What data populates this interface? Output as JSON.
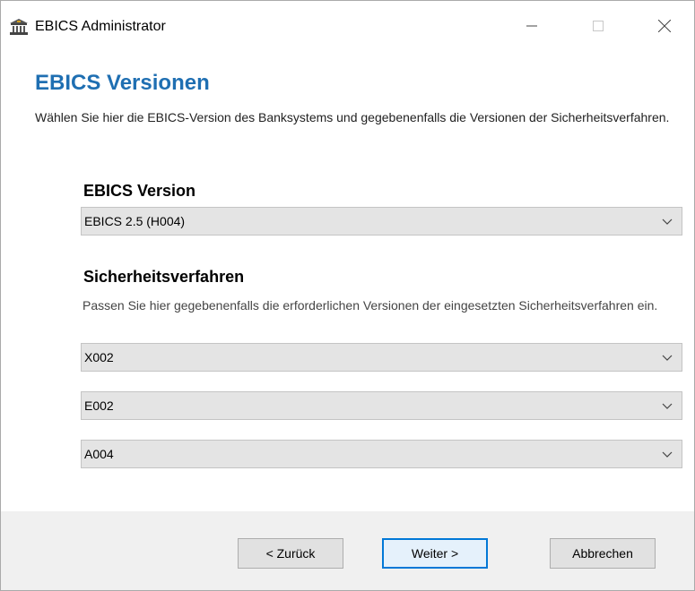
{
  "window": {
    "title": "EBICS Administrator",
    "icon": "bank-icon"
  },
  "page": {
    "heading": "EBICS Versionen",
    "description": "Wählen Sie hier die EBICS-Version des Banksystems und gegebenenfalls die Versionen der Sicherheitsverfahren."
  },
  "ebics_version": {
    "title": "EBICS Version",
    "selected": "EBICS 2.5 (H004)"
  },
  "security": {
    "title": "Sicherheitsverfahren",
    "description": "Passen Sie hier gegebenenfalls die erforderlichen Versionen der eingesetzten Sicherheitsverfahren ein.",
    "dropdowns": [
      "X002",
      "E002",
      "A004"
    ]
  },
  "buttons": {
    "back": "< Zurück",
    "next": "Weiter >",
    "cancel": "Abbrechen"
  }
}
